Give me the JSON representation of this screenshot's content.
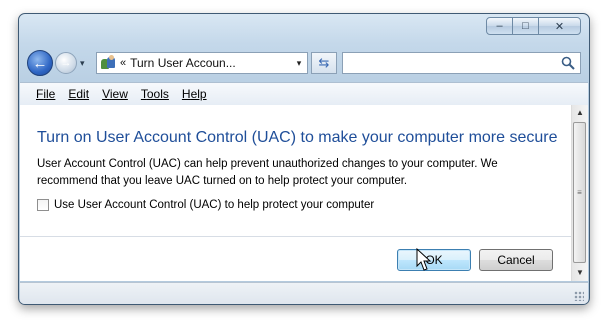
{
  "window": {
    "controls": {
      "minimize": "–",
      "maximize": "□",
      "close": "✕"
    }
  },
  "nav": {
    "back_glyph": "←",
    "forward_glyph": "→",
    "history_dropdown": "▾",
    "address_chevron": "«",
    "address_text": "Turn User Accoun...",
    "address_dropdown": "▾",
    "refresh_glyph": "⇆",
    "search_value": "",
    "search_placeholder": ""
  },
  "menu": [
    {
      "accel": "F",
      "rest": "ile"
    },
    {
      "accel": "E",
      "rest": "dit"
    },
    {
      "accel": "V",
      "rest": "iew"
    },
    {
      "accel": "T",
      "rest": "ools"
    },
    {
      "accel": "H",
      "rest": "elp"
    }
  ],
  "dialog": {
    "heading": "Turn on User Account Control (UAC) to make your computer more secure",
    "description_line1": "User Account Control (UAC) can help prevent unauthorized changes to your computer.  We",
    "description_line2": "recommend that you leave UAC turned on to help protect your computer.",
    "checkbox_label": "Use User Account Control (UAC) to help protect your computer",
    "checkbox_checked": false,
    "ok_label": "OK",
    "cancel_label": "Cancel"
  },
  "scrollbar": {
    "up": "▲",
    "down": "▼",
    "grip": "≡"
  },
  "colors": {
    "heading": "#1f4e99",
    "ok_button_border": "#3c7fb1",
    "frame": "#b9cfe3"
  },
  "icons": {
    "address": "users-icon",
    "search": "search-icon",
    "refresh": "refresh-icon"
  }
}
